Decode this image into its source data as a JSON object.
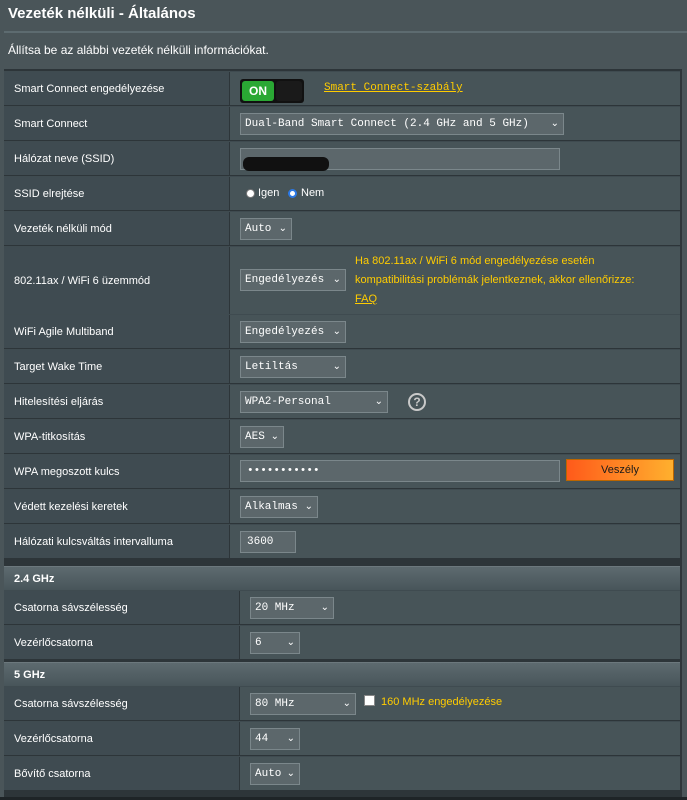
{
  "page": {
    "title": "Vezeték nélküli - Általános",
    "subtitle": "Állítsa be az alábbi vezeték nélküli információkat."
  },
  "general": {
    "smart_connect_enable": {
      "label": "Smart Connect engedélyezése",
      "toggle": "ON",
      "rule_link": "Smart Connect-szabály"
    },
    "smart_connect": {
      "label": "Smart Connect",
      "value": "Dual-Band Smart Connect (2.4 GHz and 5 GHz)"
    },
    "ssid": {
      "label": "Hálózat neve (SSID)",
      "value": ""
    },
    "hide_ssid": {
      "label": "SSID elrejtése",
      "opt_yes": "Igen",
      "opt_no": "Nem",
      "selected": "Nem"
    },
    "wireless_mode": {
      "label": "Vezeték nélküli mód",
      "value": "Auto"
    },
    "wifi6_mode": {
      "label": "802.11ax / WiFi 6 üzemmód",
      "value": "Engedélyezés",
      "note_line1": "Ha 802.11ax / WiFi 6 mód engedélyezése esetén",
      "note_line2": "kompatibilitási problémák jelentkeznek, akkor ellenőrizze:",
      "note_link": "FAQ"
    },
    "agile_multiband": {
      "label": "WiFi Agile Multiband",
      "value": "Engedélyezés"
    },
    "target_wake_time": {
      "label": "Target Wake Time",
      "value": "Letiltás"
    },
    "auth_method": {
      "label": "Hitelesítési eljárás",
      "value": "WPA2-Personal",
      "help_icon": "question-circle"
    },
    "wpa_encryption": {
      "label": "WPA-titkosítás",
      "value": "AES"
    },
    "wpa_key": {
      "label": "WPA megoszott kulcs",
      "value": "•••••••••••",
      "strength": "Veszély"
    },
    "pmf": {
      "label": "Védett kezelési keretek",
      "value": "Alkalmas"
    },
    "key_rotation": {
      "label": "Hálózati kulcsváltás intervalluma",
      "value": "3600"
    }
  },
  "band_24": {
    "header": "2.4 GHz",
    "bandwidth": {
      "label": "Csatorna sávszélesség",
      "value": "20 MHz"
    },
    "control_channel": {
      "label": "Vezérlőcsatorna",
      "value": "6"
    }
  },
  "band_5": {
    "header": "5 GHz",
    "bandwidth": {
      "label": "Csatorna sávszélesség",
      "value": "80 MHz",
      "mhz160_label": "160 MHz engedélyezése"
    },
    "control_channel": {
      "label": "Vezérlőcsatorna",
      "value": "44"
    },
    "extension_channel": {
      "label": "Bővítő csatorna",
      "value": "Auto"
    }
  },
  "colors": {
    "background": "#4a5559",
    "panel": "#2d3539",
    "label_cell": "#3f4b51",
    "value_cell": "#475458",
    "accent_yellow": "#ffcc00",
    "toggle_on": "#2aa834",
    "danger_gradient_start": "#ff5a1a"
  }
}
